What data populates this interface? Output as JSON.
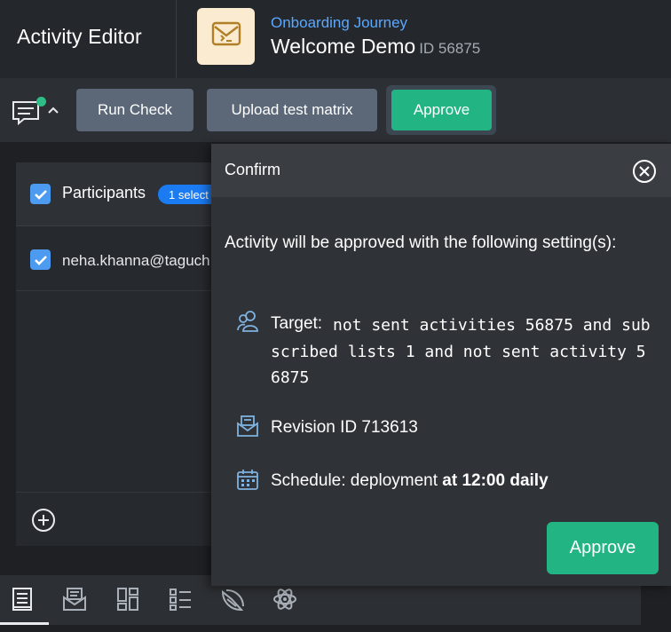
{
  "header": {
    "app_title": "Activity Editor",
    "journey_name": "Onboarding Journey",
    "activity_name": "Welcome Demo",
    "activity_id": "ID 56875",
    "tile_icon": "envelope-code-icon"
  },
  "toolbar": {
    "comment_icon": "comment-icon",
    "run_check_label": "Run Check",
    "upload_label": "Upload test matrix",
    "approve_label": "Approve"
  },
  "participants": {
    "label": "Participants",
    "badge": "1 select",
    "email": "neha.khanna@taguch",
    "checked": true
  },
  "modal": {
    "title": "Confirm",
    "intro": "Activity will be approved with the following setting(s):",
    "target_label": "Target:",
    "target_value": "not sent activities 56875 and subscribed lists 1 and not sent activity 56875",
    "revision": "Revision ID 713613",
    "schedule_prefix": "Schedule: deployment",
    "schedule_bold": "at 12:00 daily",
    "approve_label": "Approve"
  },
  "bottom_nav": [
    "document-icon",
    "envelope-icon",
    "layout-icon",
    "checklist-icon",
    "pie-chart-icon",
    "atom-icon"
  ],
  "colors": {
    "accent_green": "#22b583",
    "accent_blue": "#1b7bf2",
    "link_blue": "#5aa8ff",
    "button_gray": "#5c6878"
  }
}
